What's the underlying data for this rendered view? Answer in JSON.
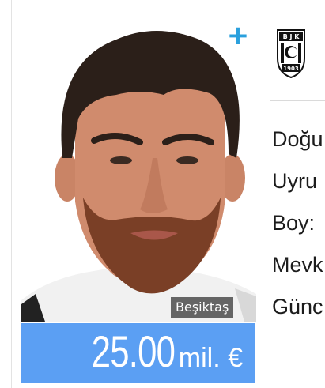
{
  "player": {
    "club": "Beşiktaş",
    "market_value": {
      "amount": "25.00",
      "unit": "mil. €"
    },
    "add_icon": "plus-icon",
    "crest_icon": "besiktas-crest-icon"
  },
  "facts": {
    "labels": [
      "Doğu",
      "Uyru",
      "Boy:",
      "Mevk",
      "Günc"
    ]
  },
  "colors": {
    "value_bg": "#5b9ff3",
    "plus": "#2aa0dd",
    "club_tag_bg": "#464646"
  }
}
